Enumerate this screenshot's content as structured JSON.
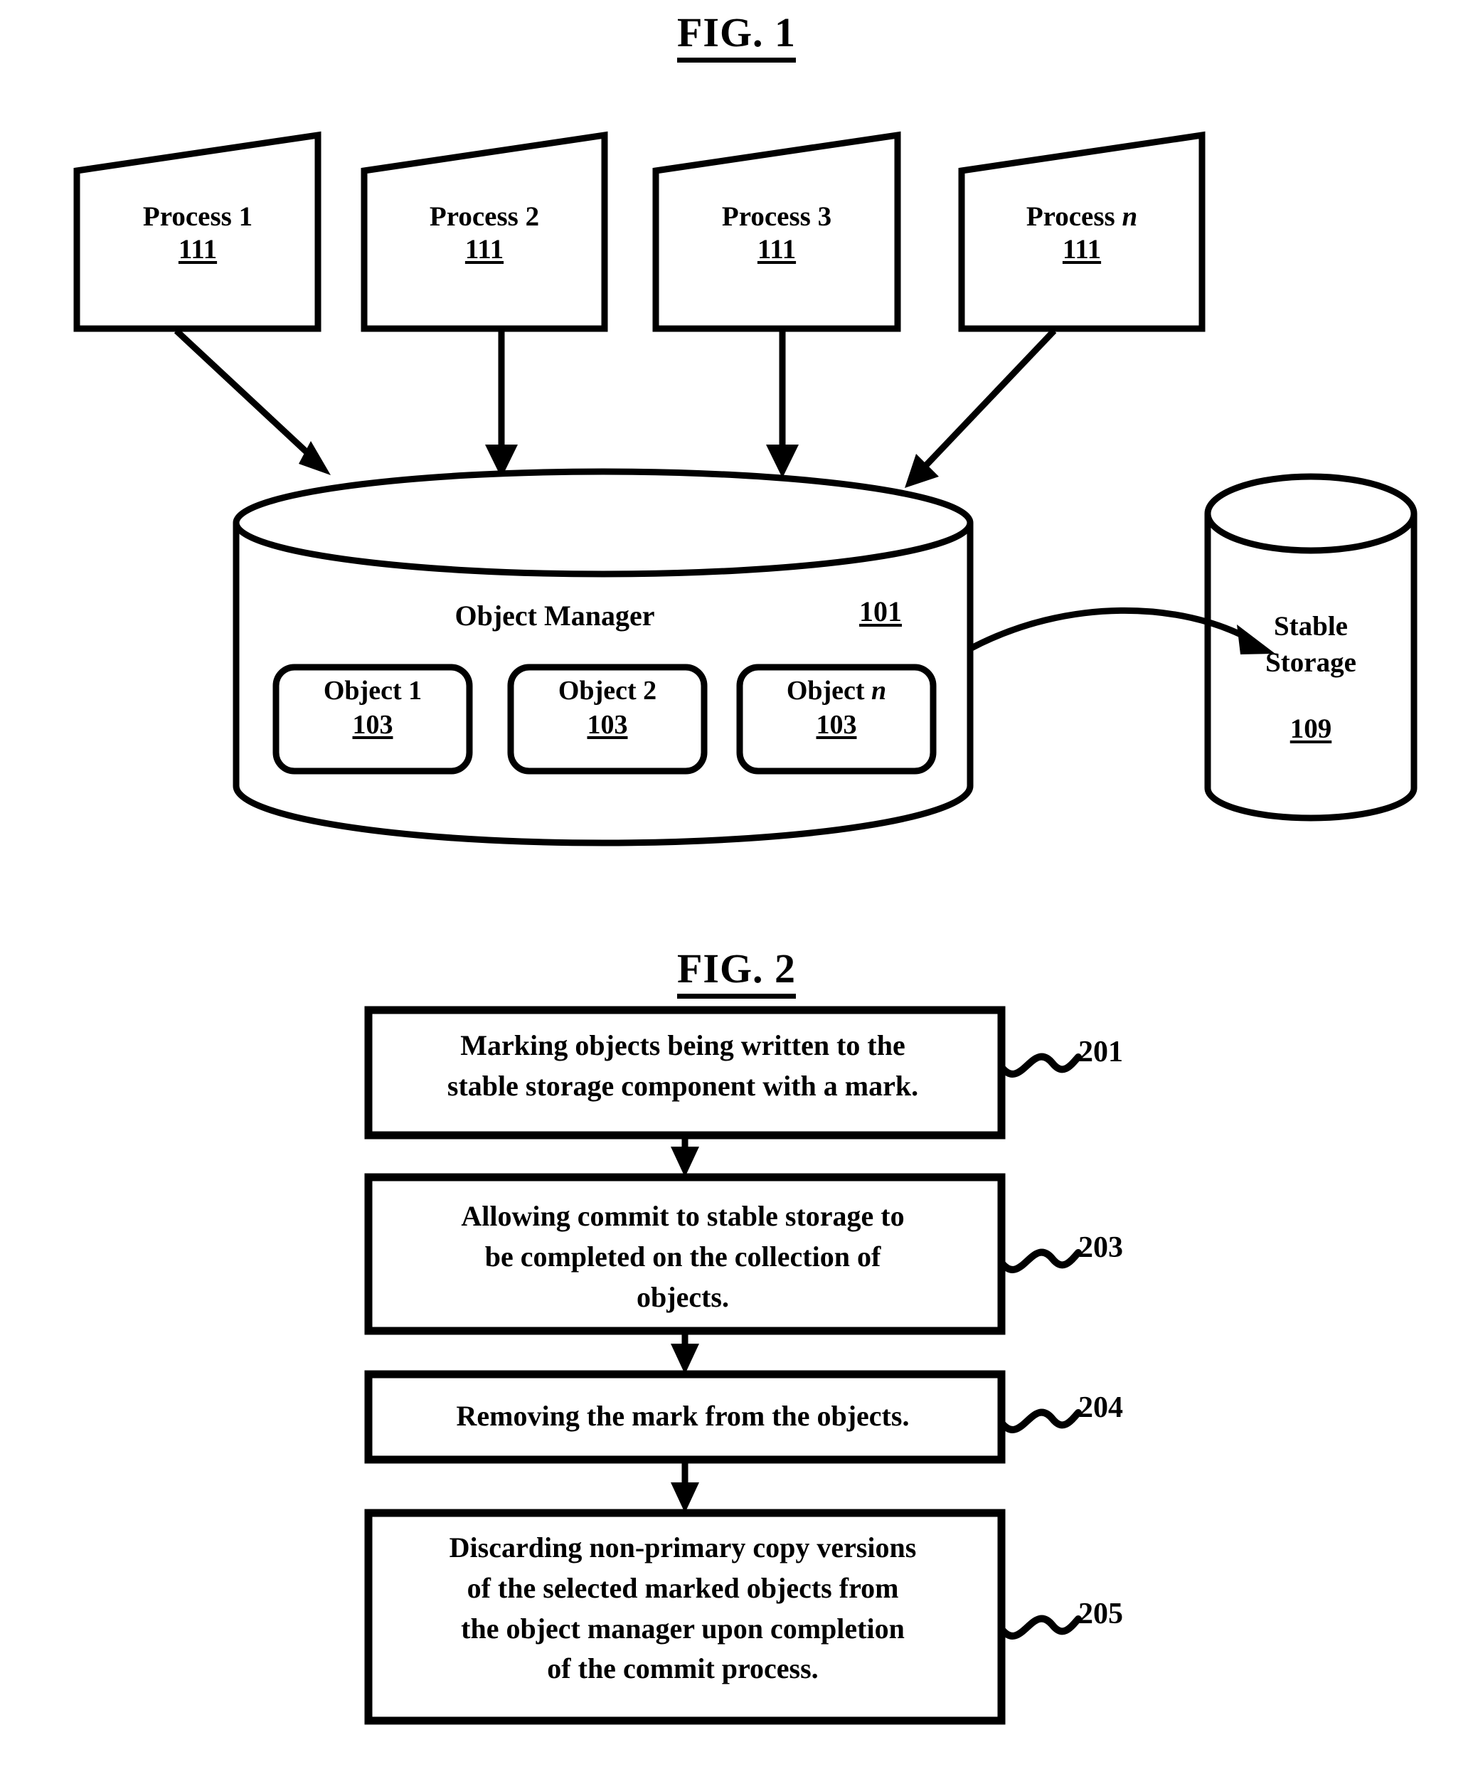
{
  "figures": [
    {
      "id": "fig1",
      "title": "FIG. 1",
      "processes": [
        {
          "name": "Process 1",
          "ref": "111"
        },
        {
          "name": "Process 2",
          "ref": "111"
        },
        {
          "name": "Process 3",
          "ref": "111"
        },
        {
          "name": "Process ",
          "name_italic": "n",
          "ref": "111"
        }
      ],
      "object_manager": {
        "label": "Object Manager",
        "ref": "101",
        "objects": [
          {
            "name": "Object 1",
            "ref": "103"
          },
          {
            "name": "Object 2",
            "ref": "103"
          },
          {
            "name": "Object ",
            "name_italic": "n",
            "ref": "103"
          }
        ]
      },
      "stable_storage": {
        "line1": "Stable",
        "line2": "Storage",
        "ref": "109"
      }
    },
    {
      "id": "fig2",
      "title": "FIG. 2",
      "steps": [
        {
          "ref": "201",
          "lines": [
            "Marking objects being written to the",
            "stable storage component with a mark."
          ]
        },
        {
          "ref": "203",
          "lines": [
            "Allowing commit to stable storage to",
            "be completed on the collection of",
            "objects."
          ]
        },
        {
          "ref": "204",
          "lines": [
            "Removing the mark from the objects."
          ]
        },
        {
          "ref": "205",
          "lines": [
            "Discarding non-primary copy versions",
            "of the selected marked objects from",
            "the object manager upon completion",
            "of the commit process."
          ]
        }
      ]
    }
  ],
  "colors": {
    "ink": "#000000",
    "paper": "#ffffff"
  }
}
